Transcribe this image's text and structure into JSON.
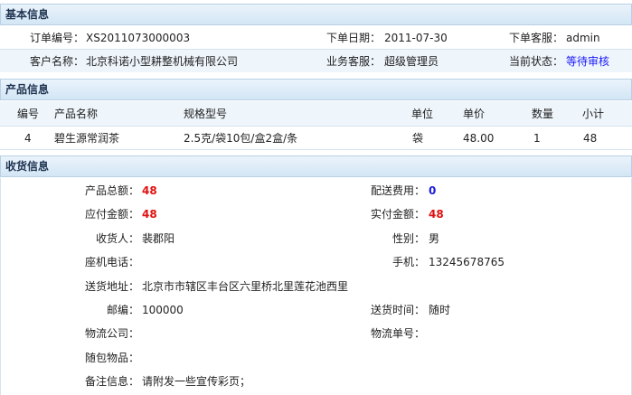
{
  "basic": {
    "title": "基本信息",
    "order_no_label": "订单编号：",
    "order_no": "XS2011073000003",
    "order_date_label": "下单日期：",
    "order_date": "2011-07-30",
    "order_staff_label": "下单客服：",
    "order_staff": "admin",
    "customer_label": "客户名称：",
    "customer": "北京科诺小型耕整机械有限公司",
    "biz_staff_label": "业务客服：",
    "biz_staff": "超级管理员",
    "status_label": "当前状态：",
    "status": "等待审核"
  },
  "product": {
    "title": "产品信息",
    "headers": [
      "编号",
      "产品名称",
      "规格型号",
      "单位",
      "单价",
      "数量",
      "小计"
    ],
    "rows": [
      [
        "4",
        "碧生源常润茶",
        "2.5克/袋10包/盒2盒/条",
        "袋",
        "48.00",
        "1",
        "48"
      ]
    ]
  },
  "receive": {
    "title": "收货信息",
    "total_label": "产品总额：",
    "total": "48",
    "shipping_fee_label": "配送费用：",
    "shipping_fee": "0",
    "payable_label": "应付金额：",
    "payable": "48",
    "paid_label": "实付金额：",
    "paid": "48",
    "receiver_label": "收货人：",
    "receiver": "裴郡阳",
    "gender_label": "性别：",
    "gender": "男",
    "phone_label": "座机电话：",
    "phone": "",
    "mobile_label": "手机：",
    "mobile": "13245678765",
    "address_label": "送货地址：",
    "address": "北京市市辖区丰台区六里桥北里莲花池西里",
    "zip_label": "邮编：",
    "zip": "100000",
    "delivery_time_label": "送货时间：",
    "delivery_time": "随时",
    "logistics_label": "物流公司：",
    "logistics": "",
    "tracking_label": "物流单号：",
    "tracking": "",
    "gift_label": "随包物品：",
    "gift": "",
    "note_label": "备注信息：",
    "note": "请附发一些宣传彩页；"
  },
  "colors": {
    "header_bg": "#d3e6f5",
    "row_bg": "#eef5fb",
    "amount_red": "#e01010",
    "status_blue": "#1a1aff"
  }
}
